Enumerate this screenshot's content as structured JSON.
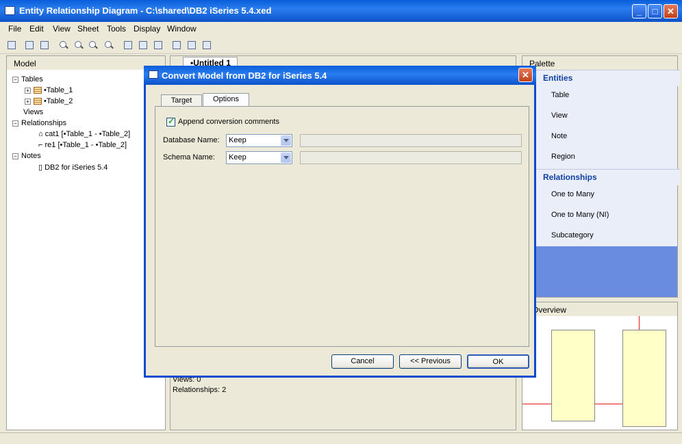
{
  "window": {
    "title": "Entity Relationship Diagram - C:\\shared\\DB2 iSeries 5.4.xed"
  },
  "menu": [
    "File",
    "Edit",
    "View",
    "Sheet",
    "Tools",
    "Display",
    "Window"
  ],
  "model": {
    "header": "Model",
    "tree": {
      "tables": "Tables",
      "table1": "•Table_1",
      "table2": "•Table_2",
      "views": "Views",
      "relationships": "Relationships",
      "rel1": "cat1 [•Table_1 - •Table_2]",
      "rel2": "re1 [•Table_1 - •Table_2]",
      "notes": "Notes",
      "note1": "DB2 for iSeries 5.4"
    }
  },
  "editor": {
    "tab": "•Untitled 1",
    "views_line": "Views: 0",
    "relationships_line": "Relationships: 2"
  },
  "palette": {
    "header": "Palette",
    "entities_label": "Entities",
    "entities": [
      "Table",
      "View",
      "Note",
      "Region"
    ],
    "relationships_label": "Relationships",
    "relationships": [
      "One to Many",
      "One to Many (NI)",
      "Subcategory"
    ]
  },
  "overview": {
    "header": "Overview"
  },
  "dialog": {
    "title": "Convert Model from DB2 for iSeries 5.4",
    "tabs": [
      "Target",
      "Options"
    ],
    "active_tab": "Options",
    "append_comments_label": "Append conversion comments",
    "append_comments_checked": true,
    "database_name_label": "Database Name:",
    "database_name_value": "Keep",
    "schema_name_label": "Schema Name:",
    "schema_name_value": "Keep",
    "cancel": "Cancel",
    "previous": "<< Previous",
    "ok": "OK"
  },
  "colors": {
    "titlebar": "#0a5fd8",
    "palette_selected": "#6a8ce0",
    "relationship_line": "#e02020"
  }
}
